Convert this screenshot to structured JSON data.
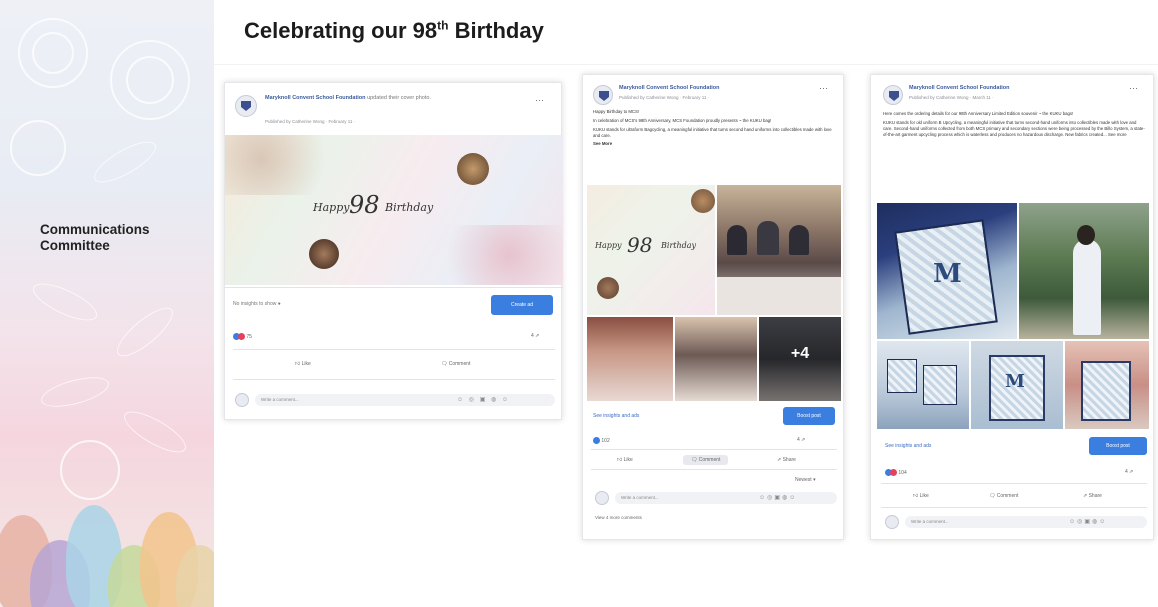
{
  "slide": {
    "title_main": "Celebrating our 98",
    "title_sup": "th",
    "title_end": " Birthday",
    "side_label_line1": "Communications",
    "side_label_line2": "Committee"
  },
  "posts": [
    {
      "page_name": "Maryknoll Convent School Foundation",
      "action_text": "updated their cover photo.",
      "meta": "Published by Catherine Wong · February 11 ·",
      "banner_script": "Happy",
      "banner_98": "98",
      "banner_script2": "Birthday",
      "insights": "No insights to show",
      "cta": "Create ad",
      "reactions_count": "75",
      "like_label": "Like",
      "comment_label": "Comment",
      "comment_placeholder": "Write a comment..."
    },
    {
      "page_name": "Maryknoll Convent School Foundation",
      "meta": "Published by Catherine Wong · February 11 ·",
      "text_lines": [
        "Happy Birthday to MCS!",
        "In celebration of MCS's 98th Anniversary, MCS Foundation proudly presents ~ the KUKU bag!",
        "KUKU stands for ultraform Bagcycling, a meaningful initiative that turns second hand uniforms into collectibles made with love and care.",
        "See More"
      ],
      "banner_98": "98",
      "more_photos": "+4",
      "insights_link": "See insights and ads",
      "cta": "Boost post",
      "reactions_count": "102",
      "like_label": "Like",
      "comment_label": "Comment",
      "share_label": "Share",
      "newest": "Newest",
      "comment_placeholder": "Write a comment...",
      "view_comments": "View 4 more comments"
    },
    {
      "page_name": "Maryknoll Convent School Foundation",
      "meta": "Published by Catherine Wong · March 11 ·",
      "text_lines": [
        "Here comes the ordering details for our 98th Anniversary Limited Edition souvenir ~ the KUKU bags!",
        "KUKU stands for old uniform B Upcycling, a meaningful initiative that turns second-hand uniforms into collectibles made with love and care. Second-hand uniforms collected from both MCS primary and secondary sections were being processed by the Billo System, a state-of-the-art garment upcycling process which is waterless and produces no hazardous discharge. New fabrics created... See more"
      ],
      "insights_link": "See insights and ads",
      "cta": "Boost post",
      "reactions_count": "104",
      "like_label": "Like",
      "comment_label": "Comment",
      "share_label": "Share",
      "comment_placeholder": "Write a comment..."
    }
  ],
  "colors": {
    "facebook_blue": "#3a7ee0",
    "link_blue": "#3b6cc4",
    "title_text": "#1c1c1c"
  }
}
